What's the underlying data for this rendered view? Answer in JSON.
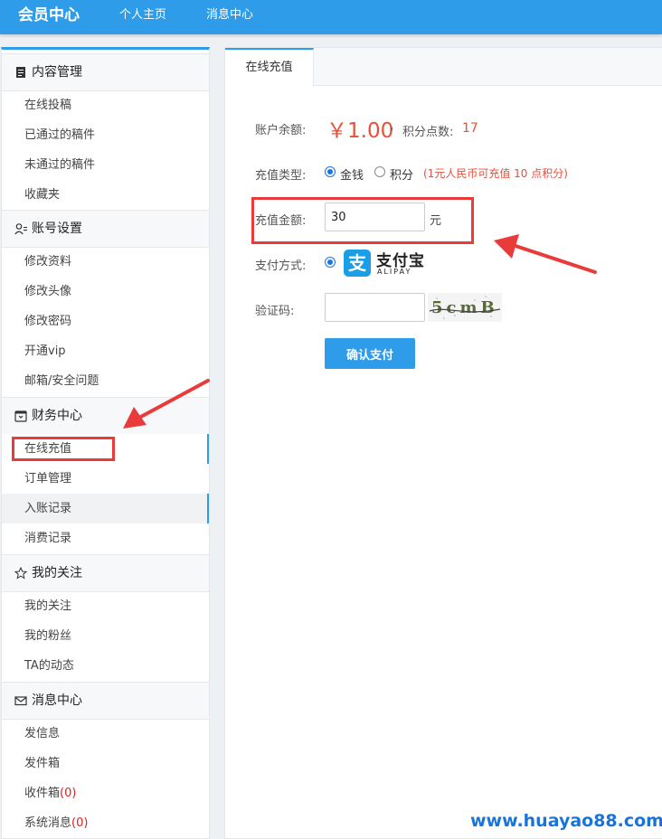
{
  "topbar": {
    "brand": "会员中心",
    "nav": [
      "个人主页",
      "消息中心"
    ]
  },
  "sidebar": {
    "sections": [
      {
        "title": "内容管理",
        "icon": "document-icon",
        "items": [
          {
            "label": "在线投稿"
          },
          {
            "label": "已通过的稿件"
          },
          {
            "label": "未通过的稿件"
          },
          {
            "label": "收藏夹"
          }
        ]
      },
      {
        "title": "账号设置",
        "icon": "user-settings-icon",
        "items": [
          {
            "label": "修改资料"
          },
          {
            "label": "修改头像"
          },
          {
            "label": "修改密码"
          },
          {
            "label": "开通vip"
          },
          {
            "label": "邮箱/安全问题"
          }
        ]
      },
      {
        "title": "财务中心",
        "icon": "wallet-icon",
        "items": [
          {
            "label": "在线充值"
          },
          {
            "label": "订单管理"
          },
          {
            "label": "入账记录"
          },
          {
            "label": "消费记录"
          }
        ]
      },
      {
        "title": "我的关注",
        "icon": "star-icon",
        "items": [
          {
            "label": "我的关注"
          },
          {
            "label": "我的粉丝"
          },
          {
            "label": "TA的动态"
          }
        ]
      },
      {
        "title": "消息中心",
        "icon": "mail-icon",
        "items": [
          {
            "label": "发信息"
          },
          {
            "label": "发件箱"
          },
          {
            "label": "收件箱",
            "count": "(0)"
          },
          {
            "label": "系统消息",
            "count": "(0)"
          }
        ]
      }
    ]
  },
  "main": {
    "tab": "在线充值",
    "balance_label": "账户余额:",
    "balance_value": "￥1.00",
    "comma": ",",
    "points_label": "积分点数:",
    "points_value": "17",
    "type_label": "充值类型:",
    "type_options": [
      "金钱",
      "积分"
    ],
    "type_hint": "(1元人民币可充值 10 点积分)",
    "amount_label": "充值金额:",
    "amount_value": "30",
    "amount_unit": "元",
    "pay_label": "支付方式:",
    "alipay_glyph": "支",
    "alipay_cn": "支付宝",
    "alipay_en": "ALIPAY",
    "captcha_label": "验证码:",
    "captcha_text": "5cmB",
    "submit": "确认支付"
  },
  "watermark": "www.huayao88.com",
  "colors": {
    "accent": "#2e9ce8",
    "price": "#e8503a",
    "annotation": "#ea3b3b"
  }
}
